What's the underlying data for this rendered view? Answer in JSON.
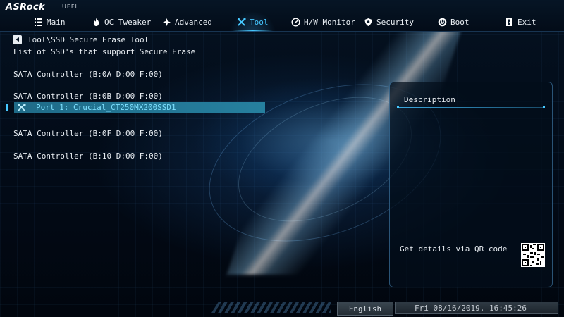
{
  "brand": {
    "logo": "ASRock",
    "sub": "UEFI"
  },
  "tabs": [
    {
      "label": "Main",
      "icon": "list-icon"
    },
    {
      "label": "OC Tweaker",
      "icon": "flame-icon"
    },
    {
      "label": "Advanced",
      "icon": "star-icon"
    },
    {
      "label": "Tool",
      "icon": "tools-icon",
      "active": true
    },
    {
      "label": "H/W Monitor",
      "icon": "monitor-icon"
    },
    {
      "label": "Security",
      "icon": "shield-icon"
    },
    {
      "label": "Boot",
      "icon": "power-icon"
    },
    {
      "label": "Exit",
      "icon": "exit-icon"
    }
  ],
  "breadcrumb": "Tool\\SSD Secure Erase Tool",
  "subtitle": "List of SSD's that support Secure Erase",
  "controllers": [
    "SATA Controller (B:0A D:00 F:00)",
    "SATA Controller (B:0B D:00 F:00)",
    "SATA Controller (B:0F D:00 F:00)",
    "SATA Controller (B:10 D:00 F:00)"
  ],
  "selected_port": "Port 1:  Crucial_CT250MX200SSD1",
  "description": {
    "title": "Description",
    "qr_text": "Get details via QR code"
  },
  "footer": {
    "language": "English",
    "datetime": "Fri 08/16/2019, 16:45:26"
  },
  "colors": {
    "accent": "#46c8ff",
    "selection": "#26809f"
  }
}
